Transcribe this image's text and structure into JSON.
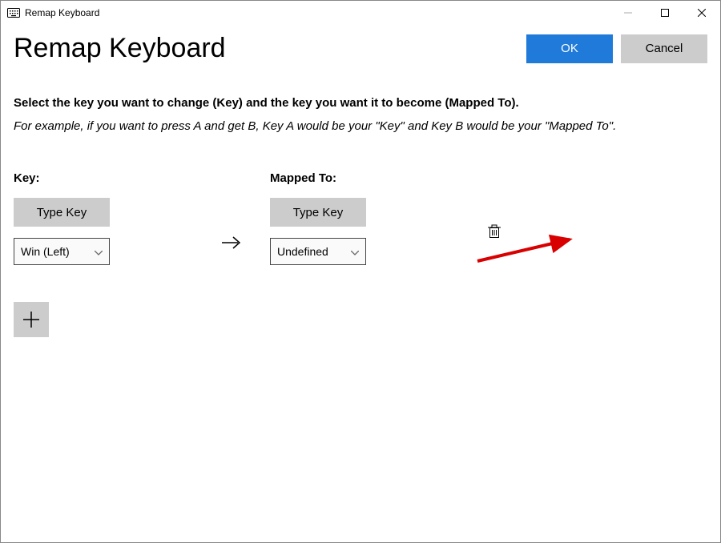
{
  "titlebar": {
    "title": "Remap Keyboard"
  },
  "header": {
    "title": "Remap Keyboard",
    "ok_label": "OK",
    "cancel_label": "Cancel"
  },
  "instructions": {
    "line1": "Select the key you want to change (Key) and the key you want it to become (Mapped To).",
    "line2": "For example, if you want to press A and get B, Key A would be your \"Key\" and Key B would be your \"Mapped To\"."
  },
  "mapping": {
    "key_label": "Key:",
    "mapped_label": "Mapped To:",
    "type_key_button": "Type Key",
    "key_selected": "Win (Left)",
    "mapped_selected": "Undefined"
  },
  "colors": {
    "accent": "#1f7ad9",
    "grey_button": "#cccccc"
  }
}
